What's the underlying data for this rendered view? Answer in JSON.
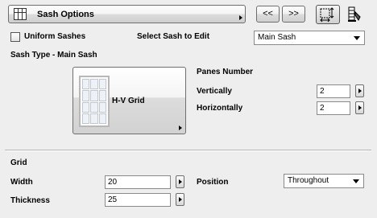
{
  "header": {
    "panel_label": "Sash Options",
    "prev_label": "<<",
    "next_label": ">>"
  },
  "options": {
    "uniform_label": "Uniform Sashes",
    "uniform_checked": false,
    "select_label": "Select Sash to Edit",
    "select_value": "Main Sash"
  },
  "sash_type": {
    "title": "Sash Type - Main Sash",
    "picker_label": "H-V Grid"
  },
  "panes": {
    "title": "Panes Number",
    "vertical_label": "Vertically",
    "vertical_value": "2",
    "horizontal_label": "Horizontally",
    "horizontal_value": "2"
  },
  "grid": {
    "title": "Grid",
    "width_label": "Width",
    "width_value": "20",
    "thickness_label": "Thickness",
    "thickness_value": "25",
    "position_label": "Position",
    "position_value": "Throughout"
  }
}
